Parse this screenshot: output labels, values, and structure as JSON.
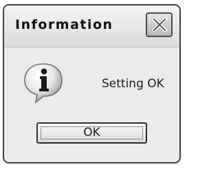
{
  "dialog": {
    "title": "Information",
    "message": "Setting OK",
    "ok_label": "OK",
    "icon": "information-icon",
    "close_icon": "close-icon"
  }
}
